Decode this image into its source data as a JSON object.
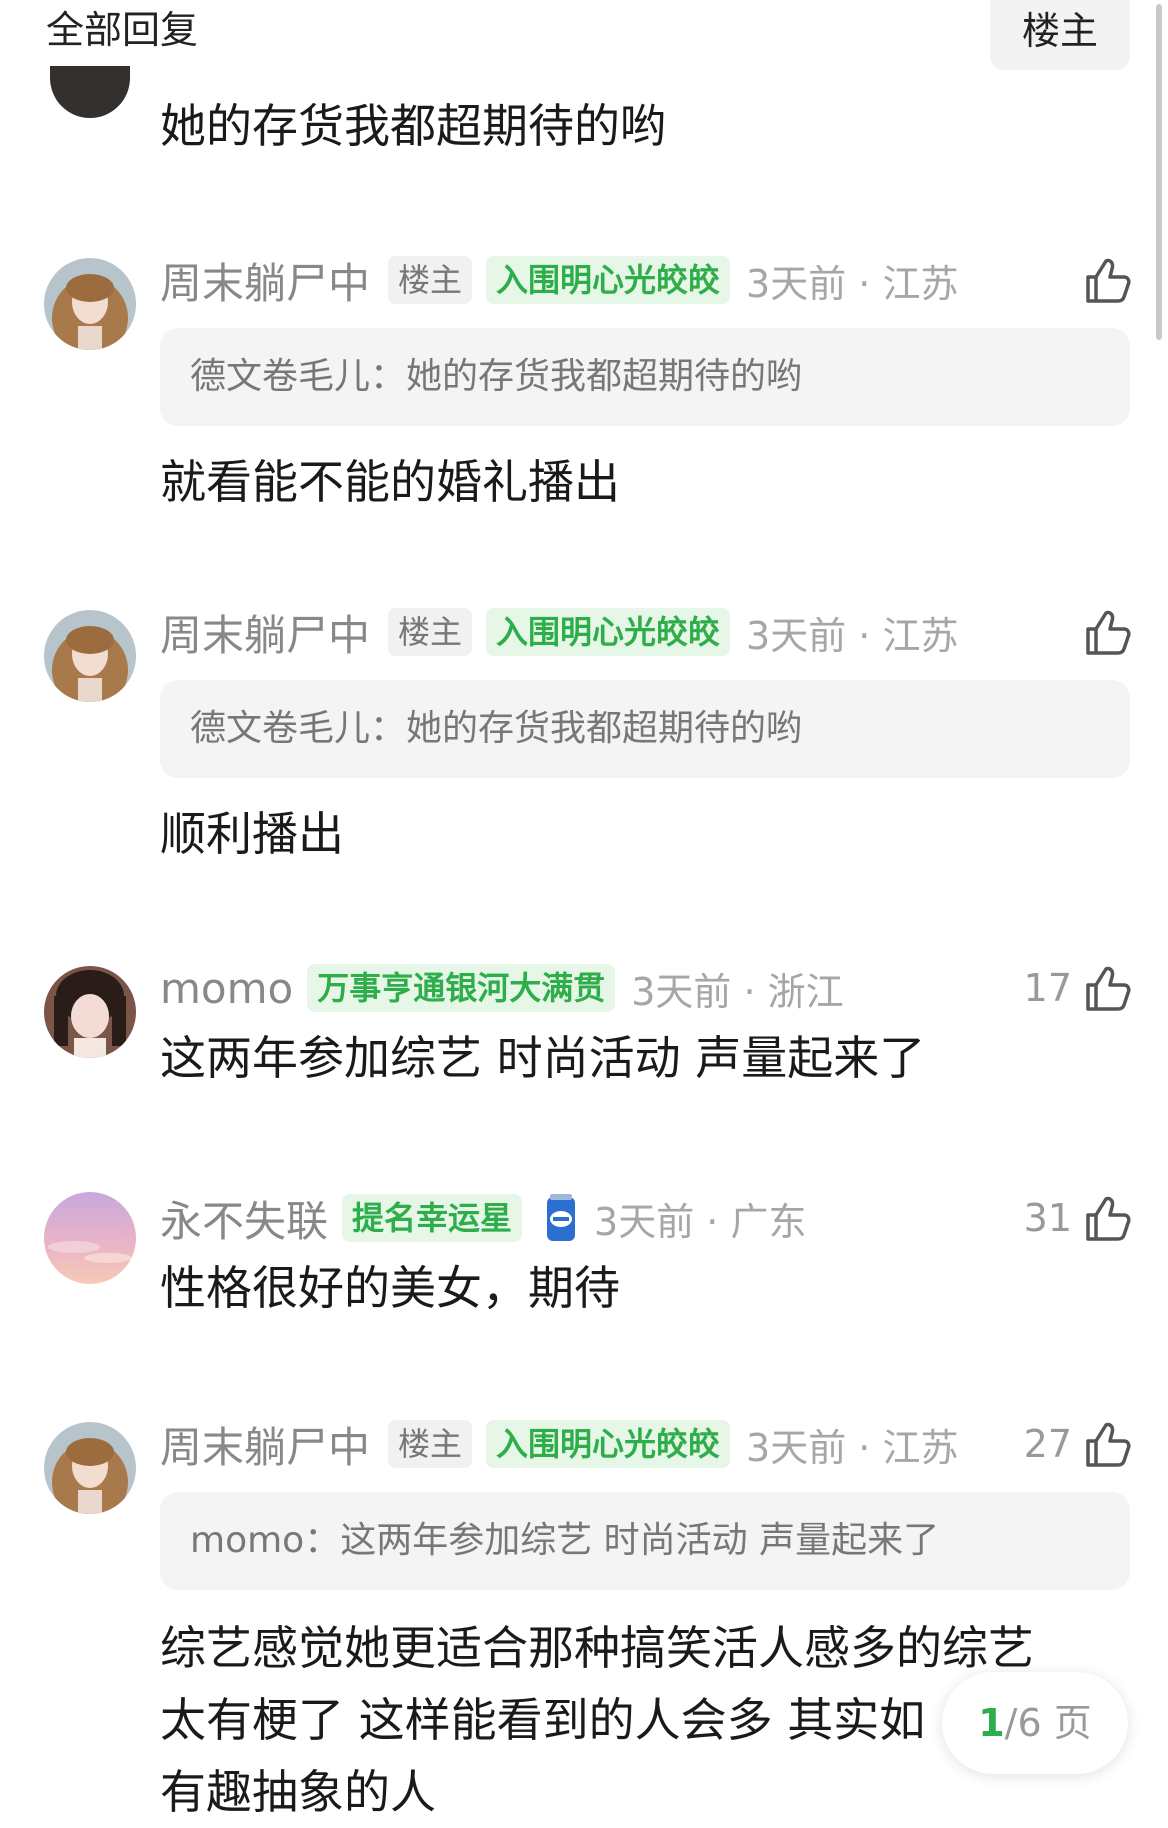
{
  "header": {
    "title": "全部回复",
    "host_button": "楼主"
  },
  "partial_comment": {
    "text": "她的存货我都超期待的哟"
  },
  "comments": [
    {
      "username": "周末躺尸中",
      "host_badge": "楼主",
      "medal": "入围明心光皎皎",
      "time": "3天前 · 江苏",
      "likes": "",
      "quote": "德文卷毛儿：她的存货我都超期待的哟",
      "text": "就看能不能的婚礼播出",
      "avatar": "curly-hair-girl"
    },
    {
      "username": "周末躺尸中",
      "host_badge": "楼主",
      "medal": "入围明心光皎皎",
      "time": "3天前 · 江苏",
      "likes": "",
      "quote": "德文卷毛儿：她的存货我都超期待的哟",
      "text": "顺利播出",
      "avatar": "curly-hair-girl"
    },
    {
      "username": "momo",
      "medal": "万事亨通银河大满贯",
      "time": "3天前 · 浙江",
      "likes": "17",
      "text": "这两年参加综艺 时尚活动 声量起来了",
      "avatar": "dark-hair-girl"
    },
    {
      "username": "永不失联",
      "medal": "提名幸运星",
      "time": "3天前 · 广东",
      "likes": "31",
      "text": "性格很好的美女，期待",
      "avatar": "pink-sky"
    },
    {
      "username": "周末躺尸中",
      "host_badge": "楼主",
      "medal": "入围明心光皎皎",
      "time": "3天前 · 江苏",
      "likes": "27",
      "quote": "momo：这两年参加综艺 时尚活动 声量起来了",
      "text_lines": [
        "综艺感觉她更适合那种搞笑活人感多的综艺",
        "太有梗了 这样能看到的人会多 其实如",
        "有趣抽象的人"
      ],
      "avatar": "curly-hair-girl"
    }
  ],
  "pager": {
    "current": "1",
    "total": "/6",
    "unit": "页"
  },
  "colors": {
    "accent_green": "#2eae4a",
    "medal_bg": "#e6f7e8",
    "quote_bg": "#f4f4f4"
  }
}
